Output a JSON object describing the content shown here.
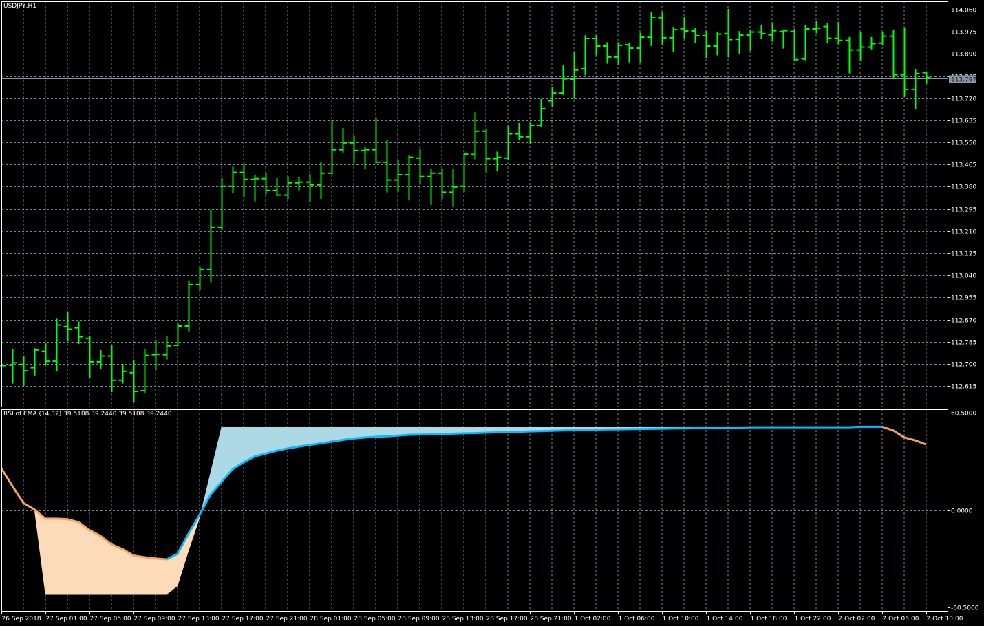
{
  "window": {
    "symbol_label": "USDJPY,H1"
  },
  "indicator": {
    "label": "RSI of EMA (14,32) 39.5108 39.2440 39.5108 39.2440"
  },
  "price_axis": {
    "ticks": [
      "114.060",
      "113.975",
      "113.890",
      "113.805",
      "113.720",
      "113.635",
      "113.550",
      "113.465",
      "113.380",
      "113.295",
      "113.210",
      "113.125",
      "113.040",
      "112.955",
      "112.870",
      "112.785",
      "112.700",
      "112.615"
    ],
    "current_price": "113.797"
  },
  "indicator_axis": {
    "ticks": [
      "60.5000",
      "0.0000",
      "-60.5000"
    ]
  },
  "time_axis": {
    "labels": [
      "26 Sep 2018",
      "27 Sep 01:00",
      "27 Sep 05:00",
      "27 Sep 09:00",
      "27 Sep 13:00",
      "27 Sep 17:00",
      "27 Sep 21:00",
      "28 Sep 01:00",
      "28 Sep 05:00",
      "28 Sep 09:00",
      "28 Sep 13:00",
      "28 Sep 17:00",
      "28 Sep 21:00",
      "1 Oct 02:00",
      "1 Oct 06:00",
      "1 Oct 10:00",
      "1 Oct 14:00",
      "1 Oct 18:00",
      "1 Oct 22:00",
      "2 Oct 02:00",
      "2 Oct 06:00",
      "2 Oct 10:00"
    ]
  },
  "colors": {
    "background": "#000000",
    "bar": "#00FF00",
    "grid": "#778899",
    "frame": "#FFFFFF",
    "current_price_line": "#8A96A6",
    "line_down": "#F4A460",
    "line_up": "#00BFFF",
    "fill_down": "#FDDBB8",
    "fill_up": "#ADD8E6",
    "grid_on_fill_down": "#7A3A10",
    "grid_on_fill_up": "#E8406A"
  },
  "chart_data": [
    {
      "type": "ohlc",
      "symbol": "USDJPY",
      "timeframe": "H1",
      "ylim": [
        112.536,
        114.089
      ],
      "bars": [
        [
          112.693,
          112.693,
          112.693,
          112.693
        ],
        [
          112.695,
          112.754,
          112.627,
          112.704
        ],
        [
          112.698,
          112.728,
          112.618,
          112.673
        ],
        [
          112.685,
          112.757,
          112.656,
          112.753
        ],
        [
          112.748,
          112.776,
          112.697,
          112.71
        ],
        [
          112.71,
          112.873,
          112.673,
          112.849
        ],
        [
          112.843,
          112.898,
          112.792,
          112.833
        ],
        [
          112.838,
          112.86,
          112.779,
          112.804
        ],
        [
          112.798,
          112.805,
          112.65,
          112.708
        ],
        [
          112.708,
          112.75,
          112.682,
          112.73
        ],
        [
          112.73,
          112.768,
          112.594,
          112.637
        ],
        [
          112.637,
          112.697,
          112.627,
          112.671
        ],
        [
          112.666,
          112.71,
          112.554,
          112.594
        ],
        [
          112.597,
          112.753,
          112.59,
          112.732
        ],
        [
          112.735,
          112.79,
          112.679,
          112.737
        ],
        [
          112.735,
          112.803,
          112.719,
          112.769
        ],
        [
          112.771,
          112.853,
          112.77,
          112.845
        ],
        [
          112.845,
          113.017,
          112.827,
          113.004
        ],
        [
          113.004,
          113.071,
          112.986,
          113.062
        ],
        [
          113.062,
          113.289,
          113.017,
          113.223
        ],
        [
          113.223,
          113.41,
          113.217,
          113.382
        ],
        [
          113.382,
          113.454,
          113.357,
          113.435
        ],
        [
          113.435,
          113.463,
          113.342,
          113.408
        ],
        [
          113.408,
          113.421,
          113.327,
          113.411
        ],
        [
          113.411,
          113.431,
          113.353,
          113.366
        ],
        [
          113.366,
          113.41,
          113.347,
          113.348
        ],
        [
          113.348,
          113.418,
          113.334,
          113.395
        ],
        [
          113.395,
          113.413,
          113.369,
          113.398
        ],
        [
          113.398,
          113.426,
          113.324,
          113.387
        ],
        [
          113.387,
          113.471,
          113.334,
          113.432
        ],
        [
          113.432,
          113.632,
          113.431,
          113.522
        ],
        [
          113.522,
          113.603,
          113.514,
          113.548
        ],
        [
          113.548,
          113.574,
          113.474,
          113.519
        ],
        [
          113.519,
          113.532,
          113.451,
          113.522
        ],
        [
          113.522,
          113.643,
          113.473,
          113.474
        ],
        [
          113.474,
          113.556,
          113.361,
          113.406
        ],
        [
          113.406,
          113.479,
          113.363,
          113.426
        ],
        [
          113.426,
          113.497,
          113.331,
          113.493
        ],
        [
          113.49,
          113.521,
          113.394,
          113.419
        ],
        [
          113.419,
          113.447,
          113.313,
          113.432
        ],
        [
          113.432,
          113.447,
          113.334,
          113.359
        ],
        [
          113.359,
          113.447,
          113.305,
          113.379
        ],
        [
          113.382,
          113.507,
          113.362,
          113.505
        ],
        [
          113.504,
          113.663,
          113.488,
          113.593
        ],
        [
          113.593,
          113.599,
          113.435,
          113.488
        ],
        [
          113.488,
          113.512,
          113.443,
          113.493
        ],
        [
          113.49,
          113.611,
          113.484,
          113.583
        ],
        [
          113.583,
          113.622,
          113.562,
          113.572
        ],
        [
          113.572,
          113.622,
          113.546,
          113.616
        ],
        [
          113.616,
          113.714,
          113.614,
          113.68
        ],
        [
          113.71,
          113.759,
          113.69,
          113.74
        ],
        [
          113.74,
          113.843,
          113.736,
          113.794
        ],
        [
          113.791,
          113.894,
          113.72,
          113.828
        ],
        [
          113.833,
          113.959,
          113.811,
          113.949
        ],
        [
          113.949,
          113.959,
          113.887,
          113.92
        ],
        [
          113.92,
          113.932,
          113.855,
          113.878
        ],
        [
          113.878,
          113.932,
          113.85,
          113.923
        ],
        [
          113.925,
          113.928,
          113.86,
          113.912
        ],
        [
          113.912,
          113.969,
          113.86,
          113.954
        ],
        [
          113.954,
          114.047,
          113.923,
          114.031
        ],
        [
          114.029,
          114.049,
          113.928,
          113.952
        ],
        [
          113.952,
          113.991,
          113.899,
          113.983
        ],
        [
          113.987,
          114.028,
          113.952,
          113.978
        ],
        [
          113.978,
          113.989,
          113.934,
          113.96
        ],
        [
          113.96,
          113.976,
          113.876,
          113.92
        ],
        [
          113.92,
          113.97,
          113.887,
          113.966
        ],
        [
          113.968,
          114.06,
          113.879,
          113.945
        ],
        [
          113.946,
          113.975,
          113.894,
          113.962
        ],
        [
          113.962,
          113.98,
          113.905,
          113.974
        ],
        [
          113.974,
          113.997,
          113.95,
          113.968
        ],
        [
          113.963,
          114.007,
          113.939,
          113.979
        ],
        [
          113.976,
          113.98,
          113.913,
          113.979
        ],
        [
          113.976,
          113.984,
          113.865,
          113.868
        ],
        [
          113.871,
          113.997,
          113.868,
          113.986
        ],
        [
          113.986,
          114.015,
          113.972,
          113.989
        ],
        [
          113.995,
          114.007,
          113.934,
          113.95
        ],
        [
          113.95,
          114.01,
          113.929,
          113.942
        ],
        [
          113.942,
          113.952,
          113.818,
          113.905
        ],
        [
          113.905,
          113.97,
          113.867,
          113.916
        ],
        [
          113.916,
          113.952,
          113.91,
          113.929
        ],
        [
          113.931,
          113.973,
          113.926,
          113.958
        ],
        [
          113.958,
          113.978,
          113.798,
          113.81
        ],
        [
          113.81,
          113.986,
          113.728,
          113.754
        ],
        [
          113.754,
          113.828,
          113.68,
          113.815
        ],
        [
          113.818,
          113.82,
          113.778,
          113.799
        ]
      ]
    },
    {
      "type": "line",
      "name": "RSI of EMA (14,32)",
      "ylim": [
        -62.64,
        62.64
      ],
      "levels": [
        60.5,
        0,
        -60.5
      ],
      "values": [
        25.9,
        15.0,
        4.4,
        0.4,
        -5.3,
        -5.3,
        -5.7,
        -7.4,
        -12.4,
        -16.0,
        -21.3,
        -24.2,
        -28.2,
        -29.3,
        -30.0,
        -30.6,
        -27.2,
        -14.6,
        -3.0,
        9.7,
        17.6,
        25.4,
        29.7,
        33.3,
        35.1,
        36.9,
        38.3,
        39.5,
        40.5,
        41.5,
        42.6,
        43.6,
        44.5,
        45.1,
        45.6,
        45.9,
        46.3,
        46.8,
        46.9,
        47.1,
        47.3,
        47.5,
        47.7,
        47.9,
        48.1,
        48.3,
        48.5,
        48.7,
        48.9,
        49.1,
        49.3,
        49.5,
        49.7,
        49.9,
        50.0,
        50.1,
        50.2,
        50.3,
        50.4,
        50.5,
        50.6,
        50.7,
        50.8,
        50.9,
        51.0,
        51.1,
        51.2,
        51.3,
        51.4,
        51.5,
        51.5,
        51.5,
        51.5,
        51.5,
        51.5,
        51.5,
        51.5,
        51.5,
        51.8,
        51.8,
        51.8,
        49.5,
        45.2,
        43.3,
        40.8
      ],
      "fill_bound": [
        null,
        null,
        null,
        0.4,
        -52.5,
        -52.5,
        -52.5,
        -52.5,
        -52.5,
        -52.5,
        -52.5,
        -52.5,
        -52.5,
        -52.5,
        -52.5,
        -52.5,
        -47.1,
        -25.3,
        -5.0,
        23.3,
        51.8,
        51.8,
        51.8,
        51.8,
        51.8,
        51.8,
        51.8,
        51.8,
        51.8,
        51.8,
        51.8,
        51.8,
        51.8,
        51.8,
        51.8,
        51.8,
        51.8,
        51.8,
        51.8,
        51.8,
        51.8,
        51.8,
        51.8,
        51.8,
        51.8,
        51.8,
        51.8,
        51.8,
        51.8,
        51.8,
        51.8,
        51.8,
        51.8,
        51.8,
        51.8,
        51.8,
        51.8,
        51.8,
        51.8,
        51.8,
        51.8,
        51.8,
        51.8,
        51.8,
        51.8,
        51.8,
        51.8,
        51.8,
        51.8,
        51.8,
        51.8,
        51.8,
        51.8,
        51.8,
        51.8,
        51.8,
        51.8,
        51.8,
        51.8,
        51.8,
        51.8,
        null,
        null,
        null,
        null
      ],
      "color_segments": [
        {
          "from": 0,
          "to": 15,
          "trend": "down"
        },
        {
          "from": 15,
          "to": 80,
          "trend": "up"
        },
        {
          "from": 80,
          "to": 84,
          "trend": "down"
        }
      ]
    }
  ]
}
